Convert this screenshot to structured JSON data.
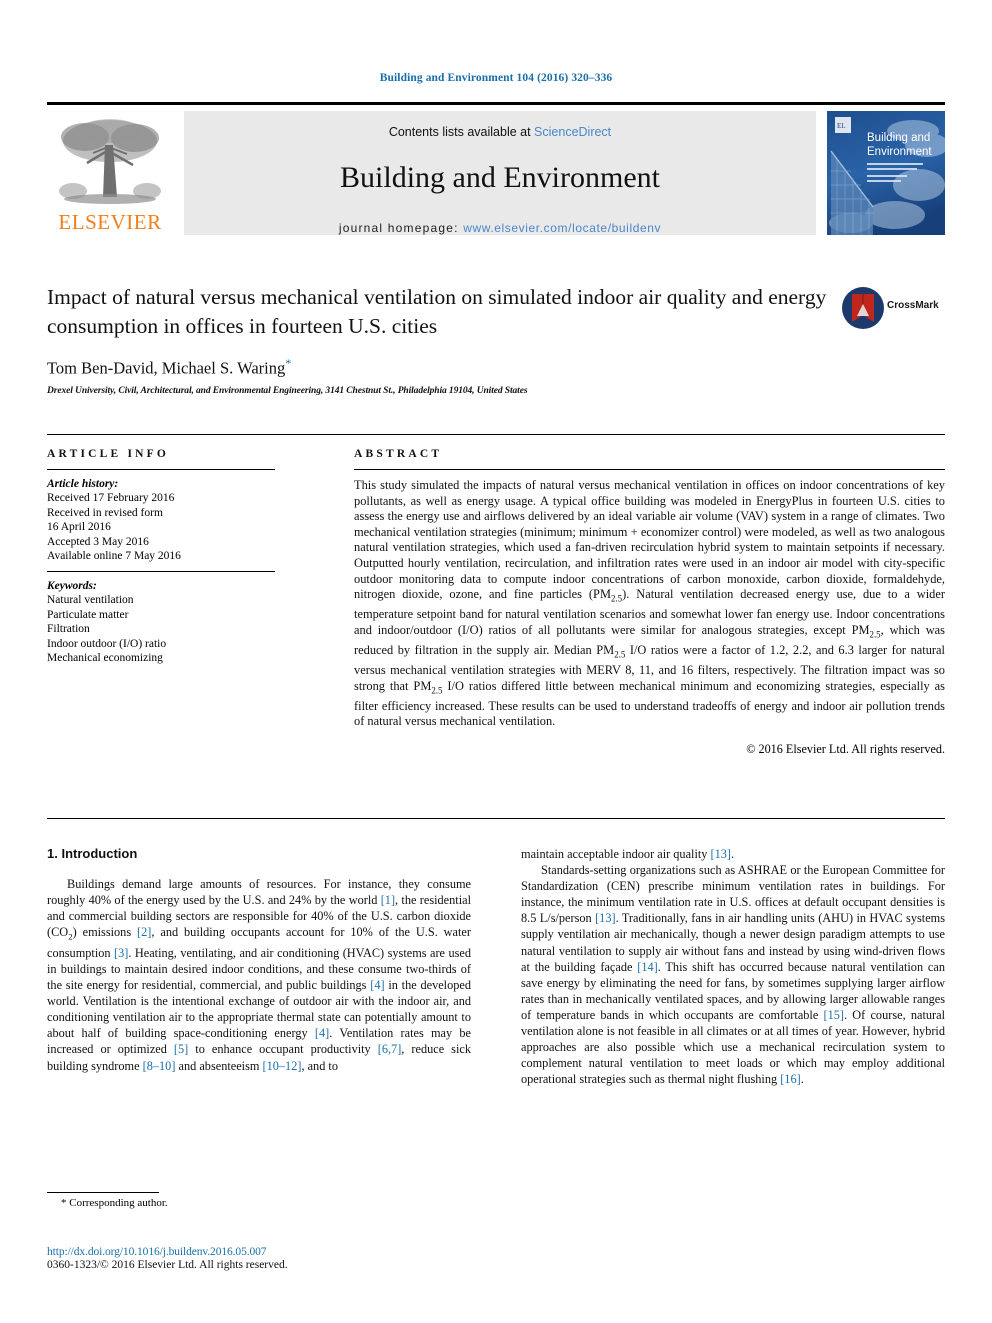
{
  "running_head": "Building and Environment 104 (2016) 320–336",
  "masthead": {
    "contents_prefix": "Contents lists available at ",
    "sciencedirect": "ScienceDirect",
    "journal_title": "Building and Environment",
    "homepage_prefix": "journal homepage: ",
    "homepage_url": "www.elsevier.com/locate/buildenv",
    "publisher_wordmark": "ELSEVIER",
    "cover_title_line1": "Building and",
    "cover_title_line2": "Environment"
  },
  "colors": {
    "link_blue": "#1a6fa8",
    "sciencedirect_blue": "#4a86c8",
    "elsevier_orange": "#F07F1A",
    "cover_blue": "#1b4a86",
    "crossmark_red": "#c0261c",
    "masthead_grey": "#e9e9e9"
  },
  "article": {
    "title": "Impact of natural versus mechanical ventilation on simulated indoor air quality and energy consumption in offices in fourteen U.S. cities",
    "authors": "Tom Ben-David, Michael S. Waring",
    "corresponding_marker": "*",
    "affiliation": "Drexel University, Civil, Architectural, and Environmental Engineering, 3141 Chestnut St., Philadelphia 19104, United States",
    "crossmark_label": "CrossMark"
  },
  "article_info": {
    "heading": "ARTICLE INFO",
    "history_label": "Article history:",
    "history": [
      "Received 17 February 2016",
      "Received in revised form",
      "16 April 2016",
      "Accepted 3 May 2016",
      "Available online 7 May 2016"
    ],
    "keywords_label": "Keywords:",
    "keywords": [
      "Natural ventilation",
      "Particulate matter",
      "Filtration",
      "Indoor outdoor (I/O) ratio",
      "Mechanical economizing"
    ]
  },
  "abstract": {
    "heading": "ABSTRACT",
    "text_part1": "This study simulated the impacts of natural versus mechanical ventilation in offices on indoor concentrations of key pollutants, as well as energy usage. A typical office building was modeled in EnergyPlus in fourteen U.S. cities to assess the energy use and airflows delivered by an ideal variable air volume (VAV) system in a range of climates. Two mechanical ventilation strategies (minimum; minimum + economizer control) were modeled, as well as two analogous natural ventilation strategies, which used a fan-driven recirculation hybrid system to maintain setpoints if necessary. Outputted hourly ventilation, recirculation, and infiltration rates were used in an indoor air model with city-specific outdoor monitoring data to compute indoor concentrations of carbon monoxide, carbon dioxide, formaldehyde, nitrogen dioxide, ozone, and fine particles (PM",
    "sub1": "2.5",
    "text_part2": "). Natural ventilation decreased energy use, due to a wider temperature setpoint band for natural ventilation scenarios and somewhat lower fan energy use. Indoor concentrations and indoor/outdoor (I/O) ratios of all pollutants were similar for analogous strategies, except PM",
    "sub2": "2.5",
    "text_part3": ", which was reduced by filtration in the supply air. Median PM",
    "sub3": "2.5",
    "text_part4": " I/O ratios were a factor of 1.2, 2.2, and 6.3 larger for natural versus mechanical ventilation strategies with MERV 8, 11, and 16 filters, respectively. The filtration impact was so strong that PM",
    "sub4": "2.5",
    "text_part5": " I/O ratios differed little between mechanical minimum and economizing strategies, especially as filter efficiency increased. These results can be used to understand tradeoffs of energy and indoor air pollution trends of natural versus mechanical ventilation.",
    "copyright": "© 2016 Elsevier Ltd. All rights reserved."
  },
  "introduction": {
    "section_number_title": "1. Introduction",
    "left_column": {
      "s1": "Buildings demand large amounts of resources. For instance, they consume roughly 40% of the energy used by the U.S. and 24% by the world ",
      "c1": "[1]",
      "s2": ", the residential and commercial building sectors are responsible for 40% of the U.S. carbon dioxide (CO",
      "sub_co2": "2",
      "s3": ") emissions ",
      "c2": "[2]",
      "s4": ", and building occupants account for 10% of the U.S. water consumption ",
      "c3": "[3]",
      "s5": ". Heating, ventilating, and air conditioning (HVAC) systems are used in buildings to maintain desired indoor conditions, and these consume two-thirds of the site energy for residential, commercial, and public buildings ",
      "c4": "[4]",
      "s6": " in the developed world. Ventilation is the intentional exchange of outdoor air with the indoor air, and conditioning ventilation air to the appropriate thermal state can potentially amount to about half of building space-conditioning energy ",
      "c5": "[4]",
      "s7": ". Ventilation rates may be increased or optimized ",
      "c6": "[5]",
      "s8": " to enhance occupant productivity ",
      "c7": "[6,7]",
      "s9": ", reduce sick building syndrome ",
      "c8": "[8–10]",
      "s10": " and absenteeism ",
      "c9": "[10–12]",
      "s11": ", and to"
    },
    "right_column": {
      "s1": "maintain acceptable indoor air quality ",
      "c1": "[13]",
      "s2": ".",
      "p2s1": "Standards-setting organizations such as ASHRAE or the European Committee for Standardization (CEN) prescribe minimum ventilation rates in buildings. For instance, the minimum ventilation rate in U.S. offices at default occupant densities is 8.5 L/s/person ",
      "p2c1": "[13]",
      "p2s2": ". Traditionally, fans in air handling units (AHU) in HVAC systems supply ventilation air mechanically, though a newer design paradigm attempts to use natural ventilation to supply air without fans and instead by using wind-driven flows at the building façade ",
      "p2c2": "[14]",
      "p2s3": ". This shift has occurred because natural ventilation can save energy by eliminating the need for fans, by sometimes supplying larger airflow rates than in mechanically ventilated spaces, and by allowing larger allowable ranges of temperature bands in which occupants are comfortable ",
      "p2c3": "[15]",
      "p2s4": ". Of course, natural ventilation alone is not feasible in all climates or at all times of year. However, hybrid approaches are also possible which use a mechanical recirculation system to complement natural ventilation to meet loads or which may employ additional operational strategies such as thermal night flushing ",
      "p2c4": "[16]",
      "p2s5": "."
    }
  },
  "footnote": {
    "marker": "*",
    "text": "Corresponding author."
  },
  "footer": {
    "doi": "http://dx.doi.org/10.1016/j.buildenv.2016.05.007",
    "issn_copyright": "0360-1323/© 2016 Elsevier Ltd. All rights reserved."
  }
}
